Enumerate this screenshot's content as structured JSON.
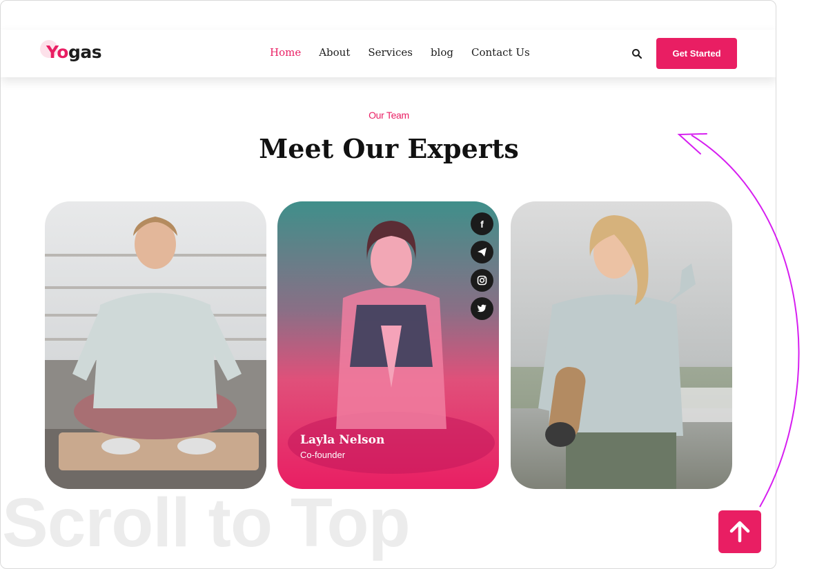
{
  "brand": {
    "logo_first": "Yo",
    "logo_rest": "gas",
    "accent": "#e91e63"
  },
  "nav": {
    "links": [
      {
        "label": "Home",
        "active": true
      },
      {
        "label": "About",
        "active": false
      },
      {
        "label": "Services",
        "active": false
      },
      {
        "label": "blog",
        "active": false
      },
      {
        "label": "Contact Us",
        "active": false
      }
    ],
    "search_icon": "search-icon",
    "cta_label": "Get Started"
  },
  "section": {
    "eyebrow": "Our Team",
    "title": "Meet Our Experts"
  },
  "team": {
    "featured": {
      "name": "Layla Nelson",
      "role": "Co-founder"
    },
    "social_icons": [
      "facebook-icon",
      "telegram-icon",
      "instagram-icon",
      "twitter-icon"
    ]
  },
  "scroll_top": {
    "watermark": "Scroll to Top",
    "icon": "arrow-up-icon"
  }
}
